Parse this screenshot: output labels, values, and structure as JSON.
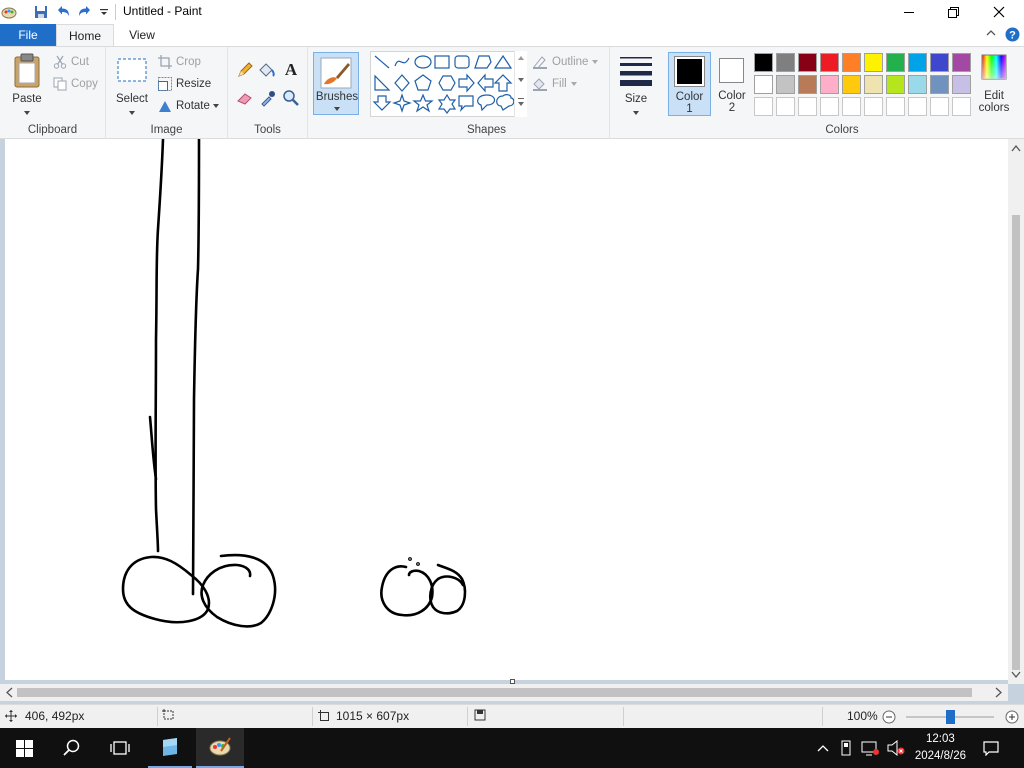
{
  "titlebar": {
    "title": "Untitled - Paint"
  },
  "tabs": {
    "file": "File",
    "home": "Home",
    "view": "View"
  },
  "clipboard": {
    "paste": "Paste",
    "cut": "Cut",
    "copy": "Copy",
    "label": "Clipboard"
  },
  "image": {
    "select": "Select",
    "crop": "Crop",
    "resize": "Resize",
    "rotate": "Rotate",
    "label": "Image"
  },
  "tools": {
    "label": "Tools",
    "items": [
      "pencil-icon",
      "fill-icon",
      "text-icon",
      "eraser-icon",
      "color-picker-icon",
      "magnifier-icon"
    ]
  },
  "brushes": {
    "label": "Brushes"
  },
  "shapes": {
    "outline": "Outline",
    "fill": "Fill",
    "label": "Shapes"
  },
  "size": {
    "label": "Size"
  },
  "colors": {
    "color1_line1": "Color",
    "color1_line2": "1",
    "color2_line1": "Color",
    "color2_line2": "2",
    "edit_line1": "Edit",
    "edit_line2": "colors",
    "label": "Colors",
    "color1_value": "#000000",
    "color2_value": "#ffffff",
    "palette_row1": [
      "#000000",
      "#7f7f7f",
      "#880015",
      "#ed1c24",
      "#ff7f27",
      "#fff200",
      "#22b14c",
      "#00a2e8",
      "#3f48cc",
      "#a349a4"
    ],
    "palette_row2": [
      "#ffffff",
      "#c3c3c3",
      "#b97a57",
      "#ffaec9",
      "#ffc90e",
      "#efe4b0",
      "#b5e61d",
      "#99d9ea",
      "#7092be",
      "#c8bfe7"
    ]
  },
  "status": {
    "cursor_pos": "406, 492px",
    "canvas_size": "1015 × 607px",
    "zoom": "100%"
  },
  "taskbar": {
    "time": "12:03",
    "date": "2024/8/26"
  }
}
